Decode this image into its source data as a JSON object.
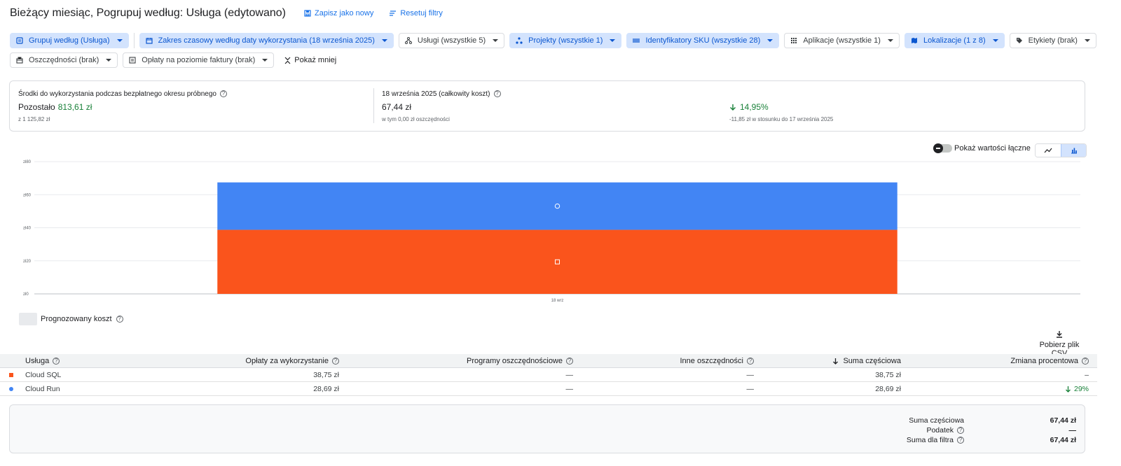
{
  "header": {
    "title": "Bieżący miesiąc, Pogrupuj według: Usługa (edytowano)",
    "save_as_new": "Zapisz jako nowy",
    "reset_filters": "Resetuj filtry"
  },
  "filters": {
    "row1": [
      {
        "label": "Grupuj według (Usługa)",
        "icon": "list-icon",
        "active": true
      },
      {
        "label": "Zakres czasowy według daty wykorzystania (18 września 2025)",
        "icon": "calendar-icon",
        "active": true
      },
      {
        "label": "Usługi (wszystkie 5)",
        "icon": "services-icon",
        "active": false
      },
      {
        "label": "Projekty (wszystkie 1)",
        "icon": "projects-icon",
        "active": true
      },
      {
        "label": "Identyfikatory SKU (wszystkie 28)",
        "icon": "sku-icon",
        "active": true
      },
      {
        "label": "Aplikacje (wszystkie 1)",
        "icon": "apps-grid-icon",
        "active": false
      },
      {
        "label": "Lokalizacje (1 z 8)",
        "icon": "map-icon",
        "active": true
      },
      {
        "label": "Etykiety (brak)",
        "icon": "label-icon",
        "active": false
      }
    ],
    "row2": [
      {
        "label": "Oszczędności (brak)",
        "icon": "savings-icon",
        "active": false
      },
      {
        "label": "Opłaty na poziomie faktury (brak)",
        "icon": "invoice-icon",
        "active": false
      }
    ],
    "show_less": "Pokaż mniej"
  },
  "summary": {
    "credits_title": "Środki do wykorzystania podczas bezpłatnego okresu próbnego",
    "remaining_label": "Pozostało",
    "remaining_value": "813,61 zł",
    "credits_total": "z 1 125,82 zł",
    "cost_title": "18 września 2025 (całkowity koszt)",
    "cost_value": "67,44 zł",
    "cost_savings": "w tym 0,00 zł oszczędności",
    "change_value": "14,95%",
    "change_note": "-11,85 zł w stosunku do 17 września 2025"
  },
  "chart_controls": {
    "cumulative_label": "Pokaż wartości łączne",
    "line_view": "line-chart-icon",
    "bar_view": "bar-chart-icon"
  },
  "chart_data": {
    "type": "bar",
    "stacked": true,
    "categories": [
      "18 wrz"
    ],
    "series": [
      {
        "name": "Cloud SQL",
        "values": [
          38.75
        ],
        "color": "#fa541c",
        "marker": "square"
      },
      {
        "name": "Cloud Run",
        "values": [
          28.69
        ],
        "color": "#4285f4",
        "marker": "circle"
      }
    ],
    "y_ticks": [
      "zł0",
      "zł20",
      "zł40",
      "zł60",
      "zł80"
    ],
    "ylim": [
      0,
      80
    ],
    "grid": true
  },
  "legend": {
    "forecast_label": "Prognozowany koszt"
  },
  "download_csv": "Pobierz plik CSV",
  "table": {
    "headers": {
      "service": "Usługa",
      "usage": "Opłaty za wykorzystanie",
      "programs": "Programy oszczędnościowe",
      "other": "Inne oszczędności",
      "subtotal": "Suma częściowa",
      "change": "Zmiana procentowa"
    },
    "rows": [
      {
        "service": "Cloud SQL",
        "usage": "38,75 zł",
        "programs": "—",
        "other": "—",
        "subtotal": "38,75 zł",
        "change": "–",
        "color": "#fa541c"
      },
      {
        "service": "Cloud Run",
        "usage": "28,69 zł",
        "programs": "—",
        "other": "—",
        "subtotal": "28,69 zł",
        "change": "29%",
        "color": "#4285f4"
      }
    ]
  },
  "totals": {
    "subtotal_label": "Suma częściowa",
    "subtotal_value": "67,44 zł",
    "tax_label": "Podatek",
    "tax_value": "—",
    "filter_total_label": "Suma dla filtra",
    "filter_total_value": "67,44 zł"
  }
}
